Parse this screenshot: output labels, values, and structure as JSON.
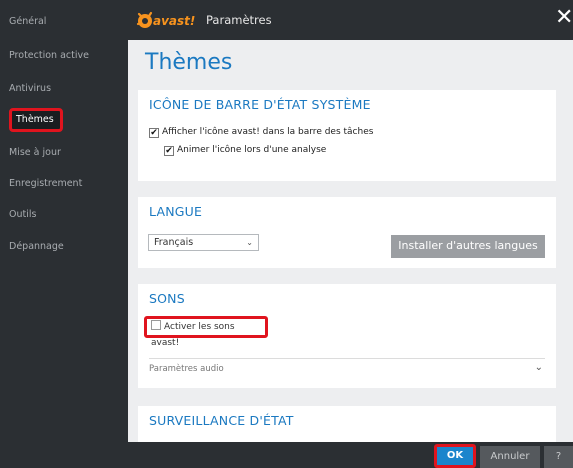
{
  "app": {
    "brand": "avast!",
    "window_title": "Paramètres",
    "close_glyph": "✕"
  },
  "sidebar": {
    "items": [
      {
        "label": "Général"
      },
      {
        "label": "Protection active"
      },
      {
        "label": "Antivirus"
      },
      {
        "label": "Thèmes",
        "active": true
      },
      {
        "label": "Mise à jour"
      },
      {
        "label": "Enregistrement"
      },
      {
        "label": "Outils"
      },
      {
        "label": "Dépannage"
      }
    ]
  },
  "main": {
    "title": "Thèmes",
    "tray": {
      "heading": "ICÔNE DE BARRE D'ÉTAT SYSTÈME",
      "options": [
        {
          "label": "Afficher l'icône avast! dans la barre des tâches",
          "checked": true
        },
        {
          "label": "Animer l'icône lors d'une analyse",
          "checked": true
        }
      ]
    },
    "language": {
      "heading": "LANGUE",
      "selected": "Français",
      "install_button": "Installer d'autres langues"
    },
    "sounds": {
      "heading": "SONS",
      "enable_label": "Activer les sons avast!",
      "enabled": false,
      "audio_settings": "Paramètres audio"
    },
    "monitoring": {
      "heading": "SURVEILLANCE D'ÉTAT"
    }
  },
  "footer": {
    "ok": "OK",
    "cancel": "Annuler",
    "help": "?"
  },
  "colors": {
    "accent": "#1b79c1",
    "sidebar_bg": "#2b2f33",
    "highlight": "#e0141e",
    "logo_orange": "#f7931e"
  },
  "icons": {
    "check": "✔",
    "chevron": "⌄",
    "close": "close-icon"
  }
}
